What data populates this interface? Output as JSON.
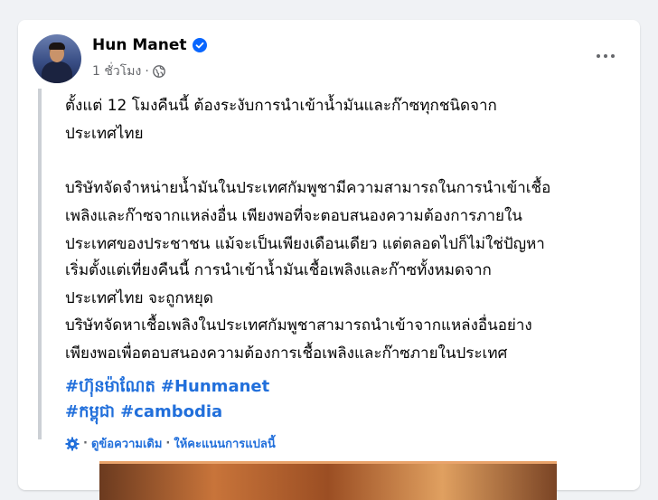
{
  "post": {
    "author": "Hun Manet",
    "time": "1 ชั่วโมง",
    "dot": "·",
    "paragraphs": [
      "ตั้งแต่ 12 โมงคืนนี้ ต้องระงับการนำเข้าน้ำมันและก๊าซทุกชนิดจาก\nประเทศไทย",
      "บริษัทจัดจำหน่ายน้ำมันในประเทศกัมพูชามีความสามารถในการนำเข้าเชื้อ\nเพลิงและก๊าซจากแหล่งอื่น เพียงพอที่จะตอบสนองความต้องการภายใน\nประเทศของประชาชน แม้จะเป็นเพียงเดือนเดียว แต่ตลอดไปก็ไม่ใช่ปัญหา",
      "เริ่มตั้งแต่เที่ยงคืนนี้ การนำเข้าน้ำมันเชื้อเพลิงและก๊าซทั้งหมดจาก\nประเทศไทย จะถูกหยุด",
      "บริษัทจัดหาเชื้อเพลิงในประเทศกัมพูชาสามารถนำเข้าจากแหล่งอื่นอย่าง\nเพียงพอเพื่อตอบสนองความต้องการเชื้อเพลิงและก๊าซภายในประเทศ"
    ],
    "hashtags": [
      [
        "#ហ៊ុនម៉ាណែត",
        "#Hunmanet"
      ],
      [
        "#កម្ពុជា",
        "#cambodia"
      ]
    ],
    "translation": {
      "sep": "·",
      "see_original": "ดูข้อความเดิม",
      "rate": "ให้คะแนนการแปลนี้"
    }
  },
  "icons": {
    "verified": "verified-badge-icon",
    "privacy": "globe-icon",
    "more": "more-options-icon",
    "settings": "gear-icon"
  },
  "colors": {
    "accent": "#0866ff",
    "link": "#216fdb",
    "secondary_text": "#65676b",
    "background": "#f0f2f5"
  }
}
